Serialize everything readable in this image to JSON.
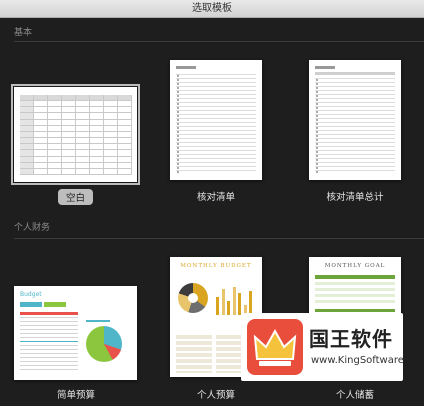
{
  "window": {
    "title": "选取模板"
  },
  "sections": [
    {
      "label": "基本"
    },
    {
      "label": "个人财务"
    }
  ],
  "templates": {
    "blank": {
      "label": "空白"
    },
    "checklist": {
      "label": "核对清单"
    },
    "checklist_total": {
      "label": "核对清单总计"
    },
    "simple_budget": {
      "label": "简单预算",
      "heading": "Budget"
    },
    "personal_budget": {
      "label": "个人预算",
      "heading": "MONTHLY BUDGET"
    },
    "personal_savings": {
      "label": "个人储蓄",
      "heading": "MONTHLY GOAL"
    }
  },
  "watermark": {
    "name": "国王软件",
    "sub": "www.KingSoftware"
  },
  "colors": {
    "accent_selected": "#bdbdbd",
    "budget_blue": "#4fb5c9",
    "budget_green": "#8cc63f",
    "budget_red": "#e8524a",
    "monthly_gold": "#d9a520",
    "goal_green": "#6ea53a",
    "watermark_red": "#e94e3c"
  }
}
